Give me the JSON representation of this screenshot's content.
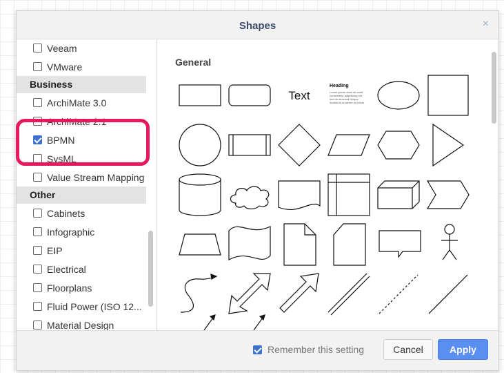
{
  "dialog": {
    "title": "Shapes",
    "close_icon": "×"
  },
  "sidebar": {
    "groups": [
      {
        "type": "item",
        "label": "Veeam",
        "checked": false
      },
      {
        "type": "item",
        "label": "VMware",
        "checked": false
      },
      {
        "type": "section",
        "label": "Business"
      },
      {
        "type": "item",
        "label": "ArchiMate 3.0",
        "checked": false
      },
      {
        "type": "item",
        "label": "ArchiMate 2.1",
        "checked": false
      },
      {
        "type": "item",
        "label": "BPMN",
        "checked": true
      },
      {
        "type": "item",
        "label": "SysML",
        "checked": false
      },
      {
        "type": "item",
        "label": "Value Stream Mapping",
        "checked": false
      },
      {
        "type": "section",
        "label": "Other"
      },
      {
        "type": "item",
        "label": "Cabinets",
        "checked": false
      },
      {
        "type": "item",
        "label": "Infographic",
        "checked": false
      },
      {
        "type": "item",
        "label": "EIP",
        "checked": false
      },
      {
        "type": "item",
        "label": "Electrical",
        "checked": false
      },
      {
        "type": "item",
        "label": "Floorplans",
        "checked": false
      },
      {
        "type": "item",
        "label": "Fluid Power (ISO 12...",
        "checked": false
      },
      {
        "type": "item",
        "label": "Material Design",
        "checked": false
      }
    ]
  },
  "main": {
    "section_title": "General",
    "shape_text": "Text",
    "heading_sample": "Heading",
    "heading_body": "Lorem ipsum dolor sit amet, consectetur adipisicing elit, sed do eiusmod tempor incididunt ut labore et dolore magna aliqua.",
    "shapes": [
      "rectangle",
      "rounded-rectangle",
      "text",
      "heading-textbox",
      "ellipse",
      "square",
      "circle",
      "process",
      "diamond",
      "parallelogram",
      "hexagon",
      "triangle",
      "cylinder",
      "cloud",
      "document",
      "internal-storage",
      "cube",
      "step",
      "trapezoid",
      "tape",
      "note",
      "card",
      "callout",
      "actor",
      "curved-arrow",
      "bidirectional-arrow",
      "arrow",
      "link",
      "dashed-line",
      "line"
    ]
  },
  "footer": {
    "remember_label": "Remember this setting",
    "remember_checked": true,
    "cancel_label": "Cancel",
    "apply_label": "Apply"
  },
  "colors": {
    "accent": "#3d72d1",
    "apply": "#5b8ef1",
    "highlight": "#e8185f"
  }
}
